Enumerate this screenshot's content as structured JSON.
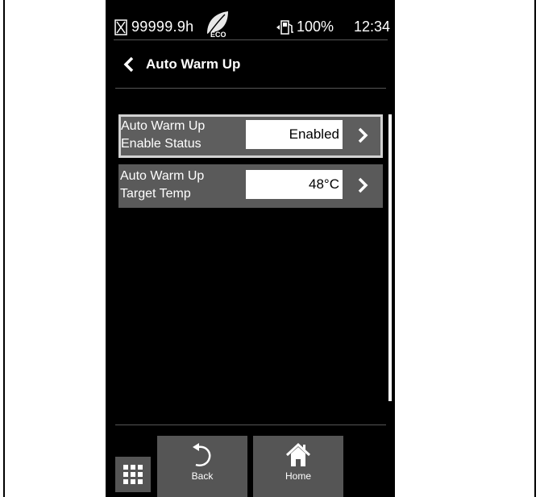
{
  "status_bar": {
    "hours": "99999.9h",
    "eco_label": "ECO",
    "fuel_percent": "100%",
    "time": "12:34"
  },
  "header": {
    "title": "Auto Warm Up"
  },
  "settings": [
    {
      "label": "Auto Warm Up\nEnable Status",
      "value": "Enabled",
      "selected": true
    },
    {
      "label": "Auto Warm Up\nTarget Temp",
      "value": "48°C",
      "selected": false
    }
  ],
  "nav": {
    "back_label": "Back",
    "home_label": "Home"
  },
  "icons": [
    "hourglass-icon",
    "eco-leaf-icon",
    "fuel-pump-icon",
    "back-chevron-icon",
    "chevron-right-icon",
    "grid-menu-icon",
    "undo-arrow-icon",
    "home-icon"
  ]
}
